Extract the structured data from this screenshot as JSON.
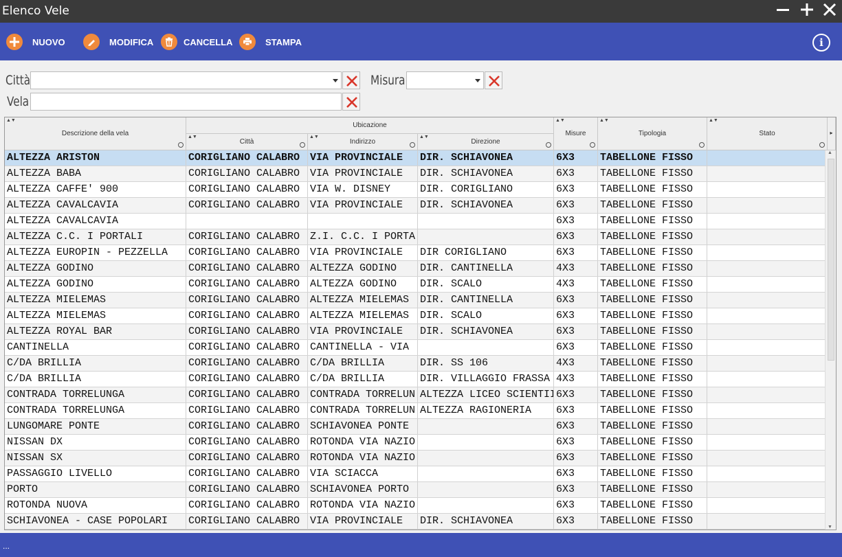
{
  "window": {
    "title": "Elenco Vele"
  },
  "toolbar": {
    "nuovo": "NUOVO",
    "modifica": "MODIFICA",
    "cancella": "CANCELLA",
    "stampa": "STAMPA",
    "accent": "#f08a3c",
    "background": "#3f51b5"
  },
  "filters": {
    "citta_label": "Città",
    "citta_value": "",
    "misura_label": "Misura",
    "misura_value": "",
    "vela_label": "Vela",
    "vela_value": ""
  },
  "grid": {
    "headers": {
      "descrizione": "Descrizione della vela",
      "ubicazione": "Ubicazione",
      "citta": "Città",
      "indirizzo": "Indirizzo",
      "direzione": "Direzione",
      "misure": "Misure",
      "tipologia": "Tipologia",
      "stato": "Stato"
    },
    "rows": [
      [
        "ALTEZZA ARISTON",
        "CORIGLIANO CALABRO",
        "VIA PROVINCIALE",
        "DIR. SCHIAVONEA",
        "6X3",
        "TABELLONE FISSO",
        ""
      ],
      [
        "ALTEZZA BABA",
        "CORIGLIANO CALABRO",
        "VIA PROVINCIALE",
        "DIR. SCHIAVONEA",
        "6X3",
        "TABELLONE FISSO",
        ""
      ],
      [
        "ALTEZZA CAFFE' 900",
        "CORIGLIANO CALABRO",
        "VIA W. DISNEY",
        "DIR. CORIGLIANO",
        "6X3",
        "TABELLONE FISSO",
        ""
      ],
      [
        "ALTEZZA CAVALCAVIA",
        "CORIGLIANO CALABRO",
        "VIA PROVINCIALE",
        "DIR. SCHIAVONEA",
        "6X3",
        "TABELLONE FISSO",
        ""
      ],
      [
        "ALTEZZA CAVALCAVIA",
        "",
        "",
        "",
        "6X3",
        "TABELLONE FISSO",
        ""
      ],
      [
        "ALTEZZA C.C. I PORTALI",
        "CORIGLIANO CALABRO",
        "Z.I. C.C. I PORTA",
        "",
        "6X3",
        "TABELLONE FISSO",
        ""
      ],
      [
        "ALTEZZA EUROPIN - PEZZELLA",
        "CORIGLIANO CALABRO",
        "VIA PROVINCIALE",
        "DIR CORIGLIANO",
        "6X3",
        "TABELLONE FISSO",
        ""
      ],
      [
        "ALTEZZA GODINO",
        "CORIGLIANO CALABRO",
        "ALTEZZA GODINO",
        "DIR. CANTINELLA",
        "4X3",
        "TABELLONE FISSO",
        ""
      ],
      [
        "ALTEZZA GODINO",
        "CORIGLIANO CALABRO",
        "ALTEZZA GODINO",
        "DIR. SCALO",
        "4X3",
        "TABELLONE FISSO",
        ""
      ],
      [
        "ALTEZZA MIELEMAS",
        "CORIGLIANO CALABRO",
        "ALTEZZA MIELEMAS",
        "DIR. CANTINELLA",
        "6X3",
        "TABELLONE FISSO",
        ""
      ],
      [
        "ALTEZZA MIELEMAS",
        "CORIGLIANO CALABRO",
        "ALTEZZA MIELEMAS",
        "DIR. SCALO",
        "6X3",
        "TABELLONE FISSO",
        ""
      ],
      [
        "ALTEZZA ROYAL BAR",
        "CORIGLIANO CALABRO",
        "VIA PROVINCIALE",
        "DIR. SCHIAVONEA",
        "6X3",
        "TABELLONE FISSO",
        ""
      ],
      [
        "CANTINELLA",
        "CORIGLIANO CALABRO",
        "CANTINELLA - VIA",
        "",
        "6X3",
        "TABELLONE FISSO",
        ""
      ],
      [
        "C/DA BRILLIA",
        "CORIGLIANO CALABRO",
        "C/DA BRILLIA",
        "DIR. SS 106",
        "4X3",
        "TABELLONE FISSO",
        ""
      ],
      [
        "C/DA BRILLIA",
        "CORIGLIANO CALABRO",
        "C/DA BRILLIA",
        "DIR. VILLAGGIO FRASSA",
        "4X3",
        "TABELLONE FISSO",
        ""
      ],
      [
        "CONTRADA TORRELUNGA",
        "CORIGLIANO CALABRO",
        "CONTRADA TORRELUN",
        "ALTEZZA LICEO SCIENTII",
        "6X3",
        "TABELLONE FISSO",
        ""
      ],
      [
        "CONTRADA TORRELUNGA",
        "CORIGLIANO CALABRO",
        "CONTRADA TORRELUN",
        "ALTEZZA RAGIONERIA",
        "6X3",
        "TABELLONE FISSO",
        ""
      ],
      [
        "LUNGOMARE PONTE",
        "CORIGLIANO CALABRO",
        "SCHIAVONEA PONTE",
        "",
        "6X3",
        "TABELLONE FISSO",
        ""
      ],
      [
        "NISSAN DX",
        "CORIGLIANO CALABRO",
        "ROTONDA VIA NAZIO",
        "",
        "6X3",
        "TABELLONE FISSO",
        ""
      ],
      [
        "NISSAN SX",
        "CORIGLIANO CALABRO",
        "ROTONDA VIA NAZIO",
        "",
        "6X3",
        "TABELLONE FISSO",
        ""
      ],
      [
        "PASSAGGIO LIVELLO",
        "CORIGLIANO CALABRO",
        "VIA SCIACCA",
        "",
        "6X3",
        "TABELLONE FISSO",
        ""
      ],
      [
        "PORTO",
        "CORIGLIANO CALABRO",
        "SCHIAVONEA PORTO",
        "",
        "6X3",
        "TABELLONE FISSO",
        ""
      ],
      [
        "ROTONDA NUOVA",
        "CORIGLIANO CALABRO",
        "ROTONDA VIA NAZIO",
        "",
        "6X3",
        "TABELLONE FISSO",
        ""
      ],
      [
        "SCHIAVONEA - CASE POPOLARI",
        "CORIGLIANO CALABRO",
        "VIA PROVINCIALE",
        "DIR. SCHIAVONEA",
        "6X3",
        "TABELLONE FISSO",
        ""
      ]
    ]
  },
  "status": {
    "text": "..."
  }
}
